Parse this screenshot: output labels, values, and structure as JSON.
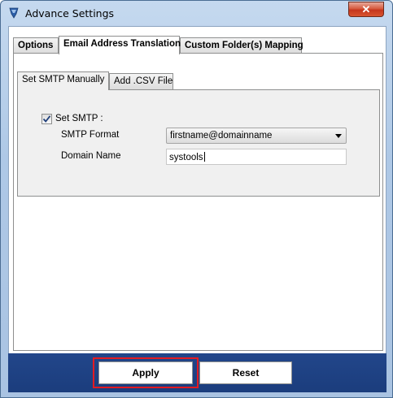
{
  "window": {
    "title": "Advance Settings",
    "close_glyph": "✕",
    "icon": "app-logo-icon",
    "accent_color": "#1b3d7d",
    "highlight_color": "#e21b22"
  },
  "outer_tabs": [
    {
      "label": "Options",
      "active": false
    },
    {
      "label": "Email Address Translation",
      "active": true
    },
    {
      "label": "Custom Folder(s) Mapping",
      "active": false
    }
  ],
  "inner_tabs": [
    {
      "label": "Set SMTP Manually",
      "active": true
    },
    {
      "label": "Add .CSV File",
      "active": false
    }
  ],
  "form": {
    "set_smtp_label": "Set SMTP :",
    "set_smtp_checked": true,
    "smtp_format_label": "SMTP Format",
    "smtp_format_value": "firstname@domainname",
    "domain_name_label": "Domain Name",
    "domain_name_value": "systools"
  },
  "buttons": {
    "apply": "Apply",
    "reset": "Reset"
  }
}
